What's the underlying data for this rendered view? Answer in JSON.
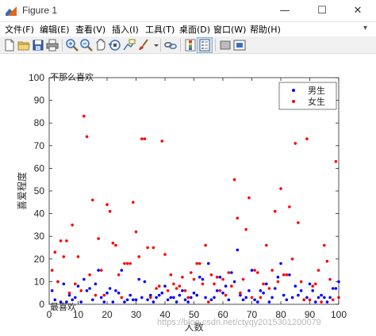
{
  "window": {
    "title": "Figure 1",
    "minimize": "—",
    "maximize": "☐",
    "close": "✕"
  },
  "menu": [
    {
      "label": "文件(F)"
    },
    {
      "label": "编辑(E)"
    },
    {
      "label": "查看(V)"
    },
    {
      "label": "插入(I)"
    },
    {
      "label": "工具(T)"
    },
    {
      "label": "桌面(D)"
    },
    {
      "label": "窗口(W)"
    },
    {
      "label": "帮助(H)"
    }
  ],
  "toolbar": {
    "icons": [
      "new-figure-icon",
      "open-file-icon",
      "save-icon",
      "print-icon",
      "zoom-in-icon",
      "zoom-out-icon",
      "pan-icon",
      "rotate-3d-icon",
      "data-cursor-icon",
      "brush-icon",
      "dropdown-icon",
      "link-icon",
      "colorbar-icon",
      "legend-icon",
      "hide-plot-tools-icon",
      "show-plot-tools-icon"
    ]
  },
  "watermark": "https://blog.csdn.net/ctyqy2015301200079",
  "colors": {
    "male": "#0000ff",
    "female": "#ff0000",
    "axes": "#262626"
  },
  "chart_data": {
    "type": "scatter",
    "xlabel": "人数",
    "ylabel": "喜爱程度",
    "xlim": [
      0,
      100
    ],
    "ylim": [
      0,
      100
    ],
    "xticks": [
      0,
      10,
      20,
      30,
      40,
      50,
      60,
      70,
      80,
      90,
      100
    ],
    "yticks": [
      0,
      10,
      20,
      30,
      40,
      50,
      60,
      70,
      80,
      90,
      100
    ],
    "grid": false,
    "legend_position": "top-right",
    "annotations": [
      {
        "text": "不那么喜欢",
        "x": 0,
        "y": 100
      },
      {
        "text": "最喜欢",
        "x": 0,
        "y": 0
      }
    ],
    "series": [
      {
        "name": "男生",
        "color": "#0000ff",
        "x": [
          1,
          2,
          3,
          4,
          5,
          6,
          7,
          8,
          9,
          10,
          11,
          12,
          13,
          14,
          15,
          16,
          17,
          18,
          19,
          20,
          21,
          22,
          23,
          24,
          25,
          26,
          27,
          28,
          29,
          30,
          31,
          32,
          33,
          34,
          35,
          36,
          37,
          38,
          39,
          40,
          41,
          42,
          43,
          44,
          45,
          46,
          47,
          48,
          49,
          50,
          51,
          52,
          53,
          54,
          55,
          56,
          57,
          58,
          59,
          60,
          61,
          62,
          63,
          64,
          65,
          66,
          67,
          68,
          69,
          70,
          71,
          72,
          73,
          74,
          75,
          76,
          77,
          78,
          79,
          80,
          81,
          82,
          83,
          84,
          85,
          86,
          87,
          88,
          89,
          90,
          91,
          92,
          93,
          94,
          95,
          96,
          97,
          98,
          99,
          100
        ],
        "y": [
          6,
          2,
          10,
          1,
          9,
          1,
          4,
          2,
          3,
          8,
          1,
          11,
          6,
          7,
          2,
          9,
          15,
          3,
          1,
          5,
          7,
          1,
          6,
          5,
          15,
          1,
          2,
          4,
          2,
          2,
          11,
          3,
          10,
          2,
          4,
          1,
          3,
          4,
          5,
          8,
          2,
          3,
          3,
          1,
          4,
          6,
          2,
          1,
          3,
          5,
          4,
          12,
          11,
          3,
          18,
          2,
          3,
          6,
          12,
          5,
          8,
          2,
          14,
          10,
          24,
          4,
          2,
          3,
          6,
          15,
          2,
          1,
          6,
          5,
          9,
          1,
          3,
          7,
          12,
          18,
          4,
          2,
          13,
          3,
          8,
          4,
          6,
          2,
          3,
          9,
          6,
          1,
          3,
          4,
          3,
          1,
          3,
          7,
          7,
          10
        ]
      },
      {
        "name": "女生",
        "color": "#ff0000",
        "x": [
          1,
          2,
          3,
          4,
          5,
          6,
          7,
          8,
          9,
          10,
          11,
          12,
          13,
          14,
          15,
          16,
          17,
          18,
          19,
          20,
          21,
          22,
          23,
          24,
          25,
          26,
          27,
          28,
          29,
          30,
          31,
          32,
          33,
          34,
          35,
          36,
          37,
          38,
          39,
          40,
          41,
          42,
          43,
          44,
          45,
          46,
          47,
          48,
          49,
          50,
          51,
          52,
          53,
          54,
          55,
          56,
          57,
          58,
          59,
          60,
          61,
          62,
          63,
          64,
          65,
          66,
          67,
          68,
          69,
          70,
          71,
          72,
          73,
          74,
          75,
          76,
          77,
          78,
          79,
          80,
          81,
          82,
          83,
          84,
          85,
          86,
          87,
          88,
          89,
          90,
          91,
          92,
          93,
          94,
          95,
          96,
          97,
          98,
          99,
          100
        ],
        "y": [
          15,
          23,
          10,
          28,
          21,
          28,
          5,
          35,
          9,
          21,
          6,
          83,
          74,
          13,
          46,
          4,
          29,
          15,
          4,
          44,
          41,
          27,
          26,
          13,
          3,
          18,
          18,
          18,
          45,
          32,
          21,
          73,
          73,
          25,
          3,
          25,
          7,
          8,
          72,
          22,
          6,
          13,
          9,
          7,
          8,
          12,
          6,
          3,
          14,
          11,
          18,
          18,
          9,
          26,
          1,
          13,
          9,
          12,
          6,
          11,
          4,
          14,
          8,
          55,
          38,
          5,
          11,
          33,
          47,
          3,
          15,
          14,
          3,
          9,
          26,
          7,
          15,
          41,
          10,
          51,
          13,
          13,
          43,
          20,
          71,
          36,
          10,
          2,
          73,
          2,
          8,
          9,
          15,
          1,
          26,
          19,
          11,
          2,
          63,
          3
        ]
      }
    ]
  }
}
